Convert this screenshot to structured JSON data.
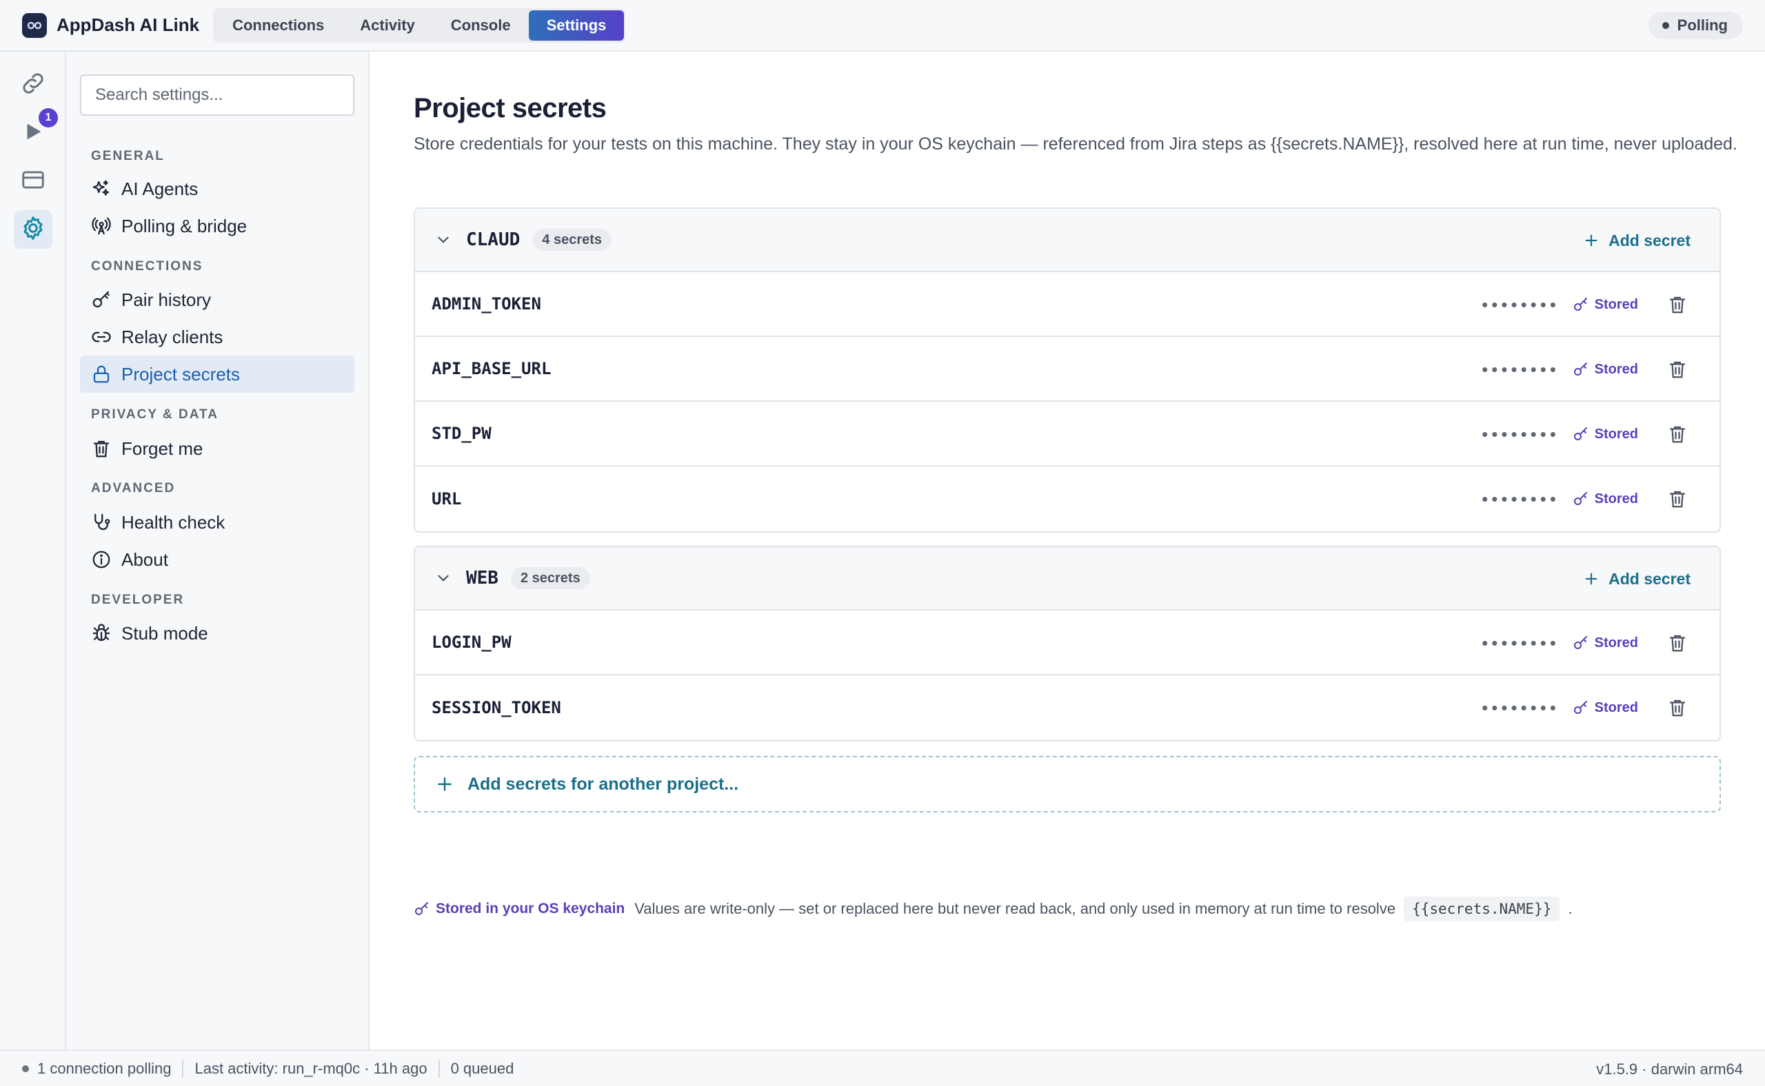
{
  "app": {
    "title": "AppDash AI Link",
    "tabs": [
      "Connections",
      "Activity",
      "Console",
      "Settings"
    ],
    "active_tab": "Settings",
    "status": "Polling"
  },
  "rail": {
    "items": [
      {
        "icon": "link-icon"
      },
      {
        "icon": "play-icon",
        "badge": "1"
      },
      {
        "icon": "window-icon"
      },
      {
        "icon": "gear-icon"
      }
    ]
  },
  "sidebar": {
    "search_placeholder": "Search settings...",
    "groups": [
      {
        "label": "GENERAL",
        "items": [
          {
            "label": "AI Agents",
            "icon": "sparkles-icon"
          },
          {
            "label": "Polling & bridge",
            "icon": "broadcast-icon"
          }
        ]
      },
      {
        "label": "CONNECTIONS",
        "items": [
          {
            "label": "Pair history",
            "icon": "key-icon"
          },
          {
            "label": "Relay clients",
            "icon": "link-icon"
          },
          {
            "label": "Project secrets",
            "icon": "lock-icon",
            "active": true
          }
        ]
      },
      {
        "label": "PRIVACY & DATA",
        "items": [
          {
            "label": "Forget me",
            "icon": "trash-icon"
          }
        ]
      },
      {
        "label": "ADVANCED",
        "items": [
          {
            "label": "Health check",
            "icon": "stethoscope-icon"
          },
          {
            "label": "About",
            "icon": "info-icon"
          }
        ]
      },
      {
        "label": "DEVELOPER",
        "items": [
          {
            "label": "Stub mode",
            "icon": "bug-icon"
          }
        ]
      }
    ]
  },
  "main": {
    "title": "Project secrets",
    "description": "Store credentials for your tests on this machine. They stay in your OS keychain — referenced from Jira steps as {{secrets.NAME}}, resolved here at run time, never uploaded.",
    "add_secret_label": "Add secret",
    "masked_value": "••••••••",
    "stored_label": "Stored",
    "projects": [
      {
        "name": "CLAUD",
        "count": "4 secrets",
        "secrets": [
          "ADMIN_TOKEN",
          "API_BASE_URL",
          "STD_PW",
          "URL"
        ]
      },
      {
        "name": "WEB",
        "count": "2 secrets",
        "secrets": [
          "LOGIN_PW",
          "SESSION_TOKEN"
        ]
      }
    ],
    "add_project_label": "Add secrets for another project...",
    "footnote": {
      "key_label": "Stored in your OS keychain",
      "text": "Values are write-only — set or replaced here but never read back, and only used in memory at run time to resolve",
      "code": "{{secrets.NAME}}",
      "end": "."
    }
  },
  "statusbar": {
    "connections": "1 connection polling",
    "last_activity": "Last activity: run_r-mq0c · 11h ago",
    "queued": "0 queued",
    "version": "v1.5.9 · darwin arm64"
  },
  "colors": {
    "accent": "#1b6f8a",
    "active_tab_start": "#2f6fb9",
    "active_tab_end": "#5640c8",
    "stored": "#5a3fb8",
    "badge": "#5b3fd0"
  }
}
